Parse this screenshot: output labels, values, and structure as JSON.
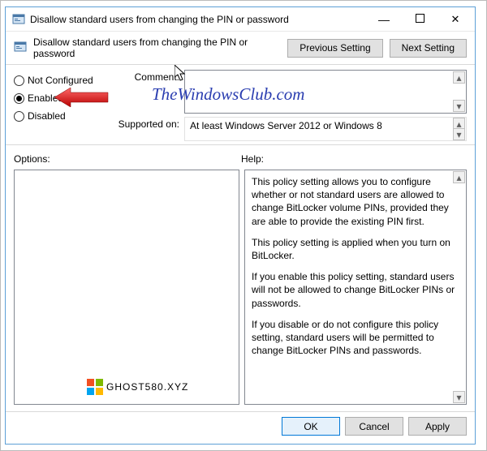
{
  "window": {
    "title": "Disallow standard users from changing the PIN or password",
    "header_text": "Disallow standard users from changing the PIN or password",
    "min": "—",
    "max": "☐",
    "close": "✕"
  },
  "nav": {
    "prev": "Previous Setting",
    "next": "Next Setting"
  },
  "state": {
    "not_configured": "Not Configured",
    "enabled": "Enabled",
    "disabled": "Disabled",
    "selected": "enabled"
  },
  "fields": {
    "comment_label": "Comment:",
    "comment_value": "",
    "supported_label": "Supported on:",
    "supported_value": "At least Windows Server 2012 or Windows 8"
  },
  "labels": {
    "options": "Options:",
    "help": "Help:"
  },
  "help": {
    "p1": "This policy setting allows you to configure whether or not standard users are allowed to change BitLocker volume PINs, provided they are able to provide the existing PIN first.",
    "p2": "This policy setting is applied when you turn on BitLocker.",
    "p3": "If you enable this policy setting, standard users will not be allowed to change BitLocker PINs or passwords.",
    "p4": "If you disable or do not configure this policy setting, standard users will be permitted to change BitLocker PINs and passwords."
  },
  "buttons": {
    "ok": "OK",
    "cancel": "Cancel",
    "apply": "Apply"
  },
  "watermarks": {
    "w1": "TheWindowsClub.com",
    "w2": "GHOST580.XYZ"
  },
  "glyphs": {
    "up": "▴",
    "down": "▾"
  }
}
